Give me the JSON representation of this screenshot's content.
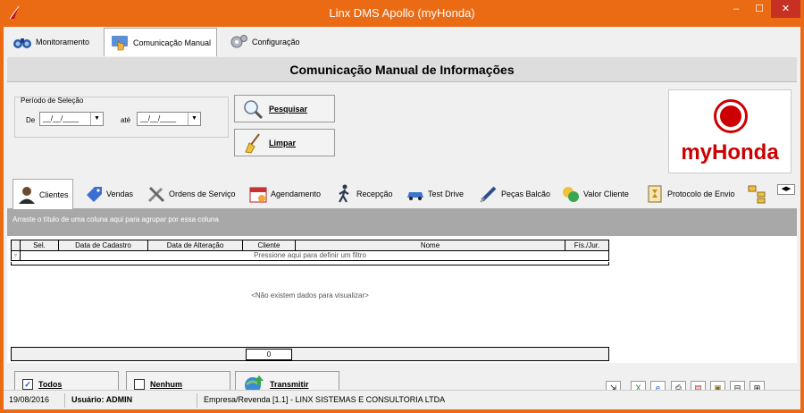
{
  "window": {
    "title": "Linx DMS Apollo (myHonda)",
    "minimize": "‒",
    "maximize": "☐",
    "close": "✕"
  },
  "top_tabs": [
    {
      "label": "Monitoramento"
    },
    {
      "label": "Comunicação Manual"
    },
    {
      "label": "Configuração"
    }
  ],
  "header_title": "Comunicação Manual de Informações",
  "period": {
    "group_label": "Período de Seleção",
    "from_label": "De",
    "to_label": "até",
    "from_value": "__/__/____",
    "to_value": "__/__/____"
  },
  "buttons": {
    "search": "Pesquisar",
    "clear": "Limpar",
    "all": "Todos",
    "none": "Nenhum",
    "transmit": "Transmitir"
  },
  "logo_text": "myHonda",
  "sub_tabs": [
    {
      "label": "Clientes"
    },
    {
      "label": "Vendas"
    },
    {
      "label": "Ordens de Serviço"
    },
    {
      "label": "Agendamento"
    },
    {
      "label": "Recepção"
    },
    {
      "label": "Test Drive"
    },
    {
      "label": "Peças Balcão"
    },
    {
      "label": "Valor Cliente"
    },
    {
      "label": "Protocolo de Envio"
    }
  ],
  "grid": {
    "group_hint": "Arraste o título de uma coluna aqui para agrupar por essa coluna",
    "columns": [
      "Sel.",
      "Data de Cadastro",
      "Data de Alteração",
      "Cliente",
      "Nome",
      "Fís./Jur."
    ],
    "filter_hint": "Pressione aqui para definir um filtro",
    "no_data": "<Não existem dados para visualizar>",
    "count": "0"
  },
  "status": {
    "date": "19/08/2016",
    "user": "Usuário: ADMIN",
    "company": "Empresa/Revenda [1.1] - LINX SISTEMAS E CONSULTORIA LTDA"
  },
  "colors": {
    "titlebar": "#eb6a14",
    "close": "#c73124",
    "brand": "#cc0000"
  }
}
